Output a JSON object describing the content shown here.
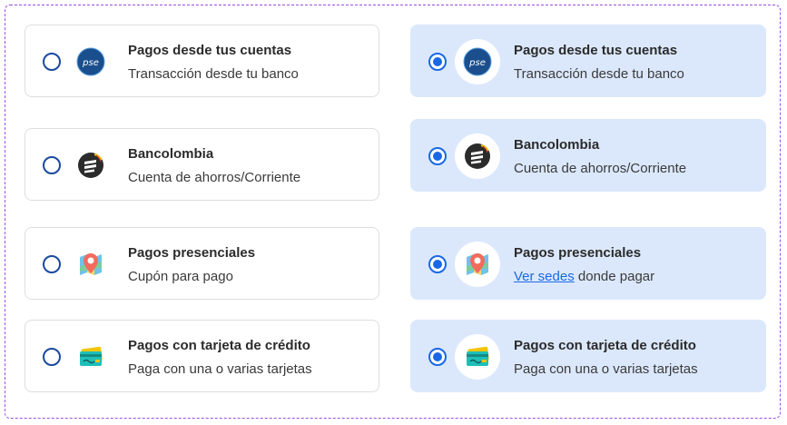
{
  "left": [
    {
      "title": "Pagos desde tus cuentas",
      "subtitle": "Transacción desde tu banco",
      "icon": "pse-icon",
      "selected": false
    },
    {
      "title": "Bancolombia",
      "subtitle": "Cuenta de ahorros/Corriente",
      "icon": "bancolombia-icon",
      "selected": false
    },
    {
      "title": "Pagos presenciales",
      "subtitle": "Cupón para pago",
      "icon": "map-pin-icon",
      "selected": false
    },
    {
      "title": "Pagos con tarjeta de crédito",
      "subtitle": "Paga con una o varias tarjetas",
      "icon": "credit-card-icon",
      "selected": false
    }
  ],
  "right": [
    {
      "title": "Pagos desde tus cuentas",
      "subtitle": "Transacción desde tu banco",
      "icon": "pse-icon",
      "selected": true
    },
    {
      "title": "Bancolombia",
      "subtitle": "Cuenta de ahorros/Corriente",
      "icon": "bancolombia-icon",
      "selected": true
    },
    {
      "title": "Pagos presenciales",
      "subtitle_link": "Ver sedes",
      "subtitle_rest": " donde pagar",
      "icon": "map-pin-icon",
      "selected": true
    },
    {
      "title": "Pagos con tarjeta de crédito",
      "subtitle": "Paga con una o varias tarjetas",
      "icon": "credit-card-icon",
      "selected": true
    }
  ],
  "pse_label": "pse",
  "colors": {
    "selected_bg": "#dbe8fc",
    "radio_blue": "#1a68e6",
    "radio_border": "#1a4a9e",
    "link": "#1a68e6",
    "frame": "#9b4fe0"
  }
}
